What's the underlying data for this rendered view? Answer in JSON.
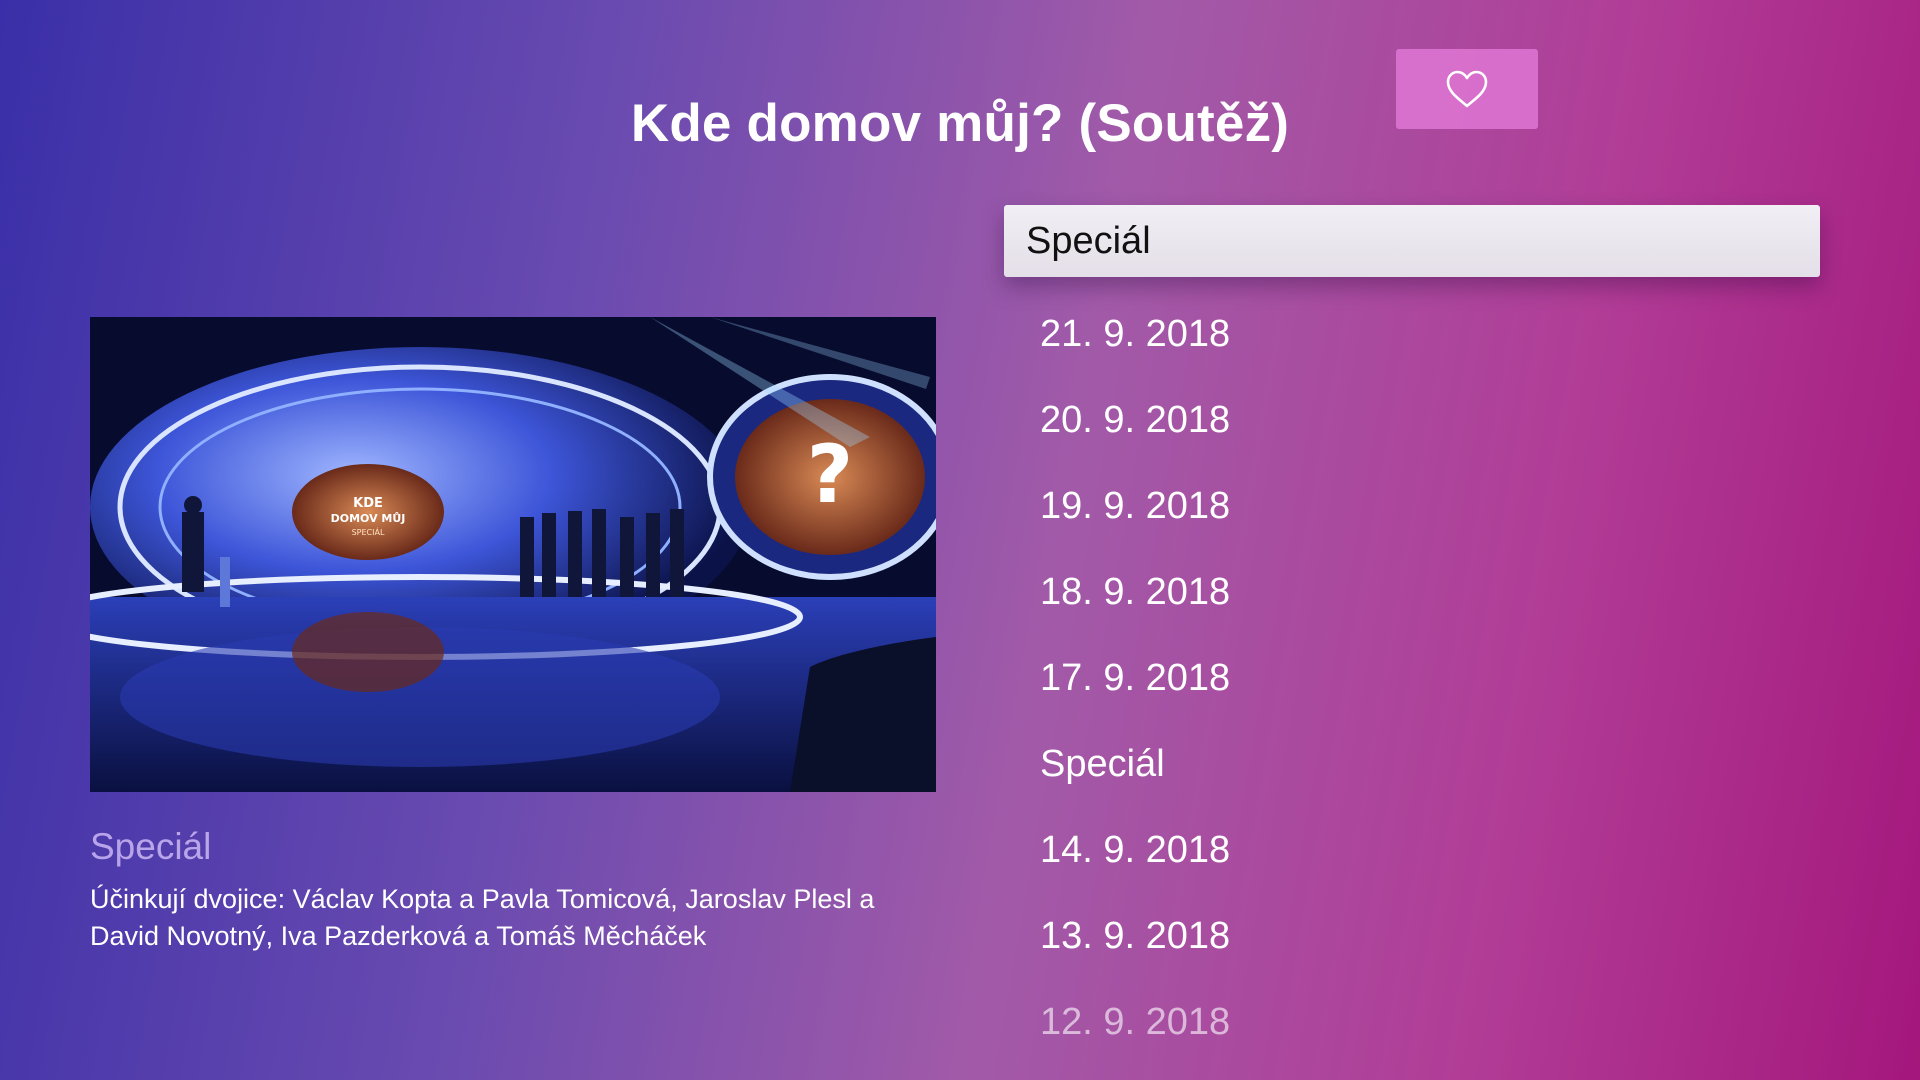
{
  "header": {
    "title": "Kde domov můj? (Soutěž)",
    "favorite_icon": "heart-outline-icon"
  },
  "detail": {
    "thumbnail_logo_text": "KDE DOMOV MŮJ SPECIÁL",
    "episode_title": "Speciál",
    "description": "Účinkují dvojice: Václav Kopta a Pavla Tomicová, Jaroslav Plesl a David Novotný, Iva Pazderková a Tomáš Měcháček"
  },
  "episodes": {
    "focused_index": 0,
    "items": [
      {
        "label": "Speciál"
      },
      {
        "label": "21. 9. 2018"
      },
      {
        "label": "20. 9. 2018"
      },
      {
        "label": "19. 9. 2018"
      },
      {
        "label": "18. 9. 2018"
      },
      {
        "label": "17. 9. 2018"
      },
      {
        "label": "Speciál"
      },
      {
        "label": "14. 9. 2018"
      },
      {
        "label": "13. 9. 2018"
      },
      {
        "label": "12. 9. 2018"
      }
    ]
  },
  "colors": {
    "gradient_start": "#3a2fa8",
    "gradient_mid": "#a25aa8",
    "gradient_end": "#a4177c",
    "favorite_button_bg": "#e078d6",
    "focused_item_bg": "#ece8f0"
  }
}
